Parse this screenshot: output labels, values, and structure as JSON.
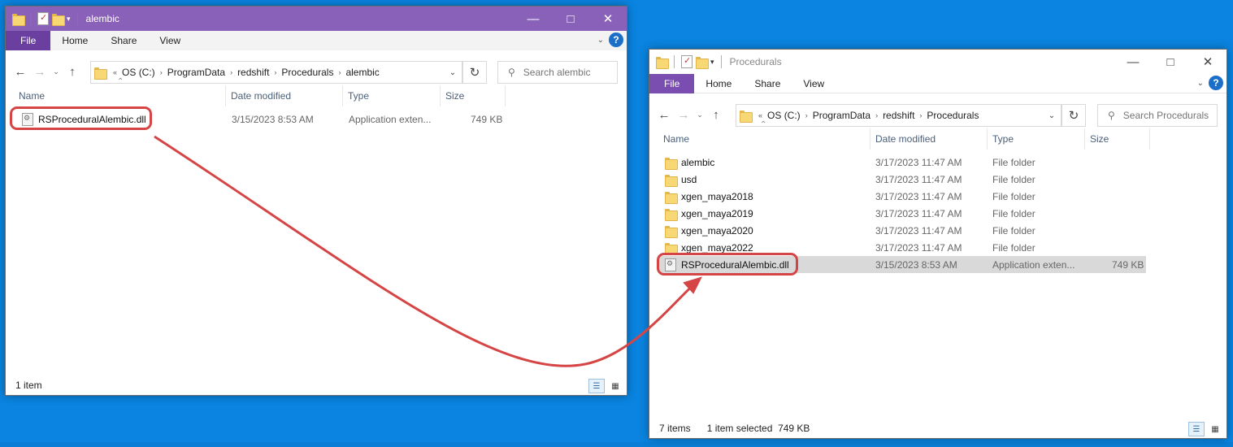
{
  "colors": {
    "accent": "#8961b8",
    "annotation": "#d64545",
    "desktop": "#0a84e0"
  },
  "window1": {
    "title": "alembic",
    "ribbon_tabs": [
      "File",
      "Home",
      "Share",
      "View"
    ],
    "help": "?",
    "breadcrumb": [
      "OS (C:)",
      "ProgramData",
      "redshift",
      "Procedurals",
      "alembic"
    ],
    "search_placeholder": "Search alembic",
    "columns": [
      "Name",
      "Date modified",
      "Type",
      "Size"
    ],
    "rows": [
      {
        "name": "RSProceduralAlembic.dll",
        "date": "3/15/2023 8:53 AM",
        "type": "Application exten...",
        "size": "749 KB",
        "icon": "dll-icon"
      }
    ],
    "status": {
      "count": "1 item"
    }
  },
  "window2": {
    "title": "Procedurals",
    "ribbon_tabs": [
      "File",
      "Home",
      "Share",
      "View"
    ],
    "help": "?",
    "breadcrumb": [
      "OS (C:)",
      "ProgramData",
      "redshift",
      "Procedurals"
    ],
    "search_placeholder": "Search Procedurals",
    "columns": [
      "Name",
      "Date modified",
      "Type",
      "Size"
    ],
    "rows": [
      {
        "name": "alembic",
        "date": "3/17/2023 11:47 AM",
        "type": "File folder",
        "size": "",
        "icon": "folder-icon"
      },
      {
        "name": "usd",
        "date": "3/17/2023 11:47 AM",
        "type": "File folder",
        "size": "",
        "icon": "folder-icon"
      },
      {
        "name": "xgen_maya2018",
        "date": "3/17/2023 11:47 AM",
        "type": "File folder",
        "size": "",
        "icon": "folder-icon"
      },
      {
        "name": "xgen_maya2019",
        "date": "3/17/2023 11:47 AM",
        "type": "File folder",
        "size": "",
        "icon": "folder-icon"
      },
      {
        "name": "xgen_maya2020",
        "date": "3/17/2023 11:47 AM",
        "type": "File folder",
        "size": "",
        "icon": "folder-icon"
      },
      {
        "name": "xgen_maya2022",
        "date": "3/17/2023 11:47 AM",
        "type": "File folder",
        "size": "",
        "icon": "folder-icon"
      },
      {
        "name": "RSProceduralAlembic.dll",
        "date": "3/15/2023 8:53 AM",
        "type": "Application exten...",
        "size": "749 KB",
        "icon": "dll-icon"
      }
    ],
    "status": {
      "count": "7 items",
      "selection": "1 item selected  749 KB"
    }
  }
}
